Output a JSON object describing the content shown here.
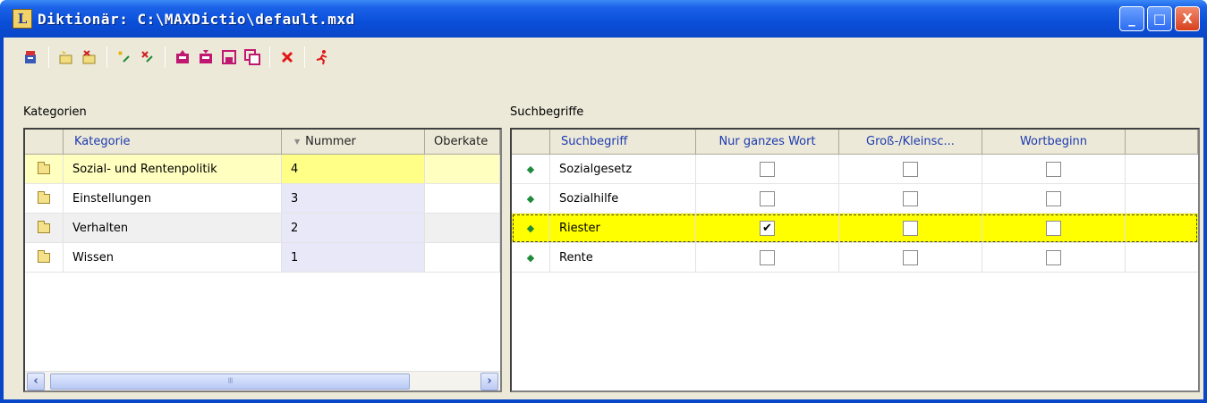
{
  "window": {
    "app_icon_letter": "L",
    "title": "Diktionär: C:\\MAXDictio\\default.mxd"
  },
  "titlebar_buttons": {
    "minimize": "_",
    "maximize": "□",
    "close": "X"
  },
  "toolbar": {
    "icons": [
      "open-icon",
      "new-folder-icon",
      "delete-folder-icon",
      "new-entry-icon",
      "delete-entry-icon",
      "import-icon",
      "export-icon",
      "save-icon",
      "save-as-icon",
      "delete-icon",
      "run-icon"
    ]
  },
  "categories": {
    "section_label": "Kategorien",
    "columns": [
      "Kategorie",
      "Nummer",
      "Oberkate"
    ],
    "sort_indicator": "▼",
    "rows": [
      {
        "name": "Sozial- und Rentenpolitik",
        "number": "4"
      },
      {
        "name": "Einstellungen",
        "number": "3"
      },
      {
        "name": "Verhalten",
        "number": "2"
      },
      {
        "name": "Wissen",
        "number": "1"
      }
    ],
    "scroll_thumb_grip": "III"
  },
  "terms": {
    "section_label": "Suchbegriffe",
    "columns": [
      "Suchbegriff",
      "Nur ganzes Wort",
      "Groß-/Kleinsc...",
      "Wortbeginn"
    ],
    "rows": [
      {
        "term": "Sozialgesetz",
        "whole_word": false,
        "case": false,
        "word_start": false
      },
      {
        "term": "Sozialhilfe",
        "whole_word": false,
        "case": false,
        "word_start": false
      },
      {
        "term": "Riester",
        "whole_word": true,
        "case": false,
        "word_start": false
      },
      {
        "term": "Rente",
        "whole_word": false,
        "case": false,
        "word_start": false
      }
    ],
    "check_mark": "✔",
    "row_marker": "◆"
  },
  "colors": {
    "title_bar": "#0a46c8",
    "selection_yellow": "#ffff00",
    "header_text": "#1c3ab0"
  }
}
